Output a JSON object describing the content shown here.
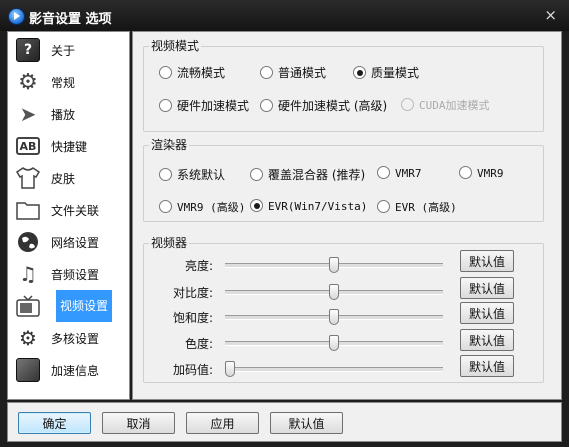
{
  "window": {
    "title": "影音设置 选项",
    "close_label": "×"
  },
  "sidebar": {
    "items": [
      {
        "label": "关于",
        "icon": "help-book-icon"
      },
      {
        "label": "常规",
        "icon": "gear-icon"
      },
      {
        "label": "播放",
        "icon": "play-arrow-icon"
      },
      {
        "label": "快捷键",
        "icon": "keyboard-ab-icon"
      },
      {
        "label": "皮肤",
        "icon": "tshirt-icon"
      },
      {
        "label": "文件关联",
        "icon": "folder-icon"
      },
      {
        "label": "网络设置",
        "icon": "globe-icon"
      },
      {
        "label": "音频设置",
        "icon": "music-note-icon"
      },
      {
        "label": "视频设置",
        "icon": "tv-icon"
      },
      {
        "label": "多核设置",
        "icon": "chip-gear-icon"
      },
      {
        "label": "加速信息",
        "icon": "info-panel-icon"
      }
    ],
    "selected": "视频设置"
  },
  "video_mode": {
    "title": "视频模式",
    "options": [
      "流畅模式",
      "普通模式",
      "质量模式",
      "硬件加速模式",
      "硬件加速模式 (高级)",
      "CUDA加速模式"
    ],
    "selected": "质量模式",
    "disabled": [
      "CUDA加速模式"
    ]
  },
  "renderer": {
    "title": "渲染器",
    "options": [
      "系统默认",
      "覆盖混合器 (推荐)",
      "VMR7",
      "VMR9",
      "VMR9 (高级)",
      "EVR(Win7/Vista)",
      "EVR (高级)"
    ],
    "selected": "EVR(Win7/Vista)"
  },
  "video_adjust": {
    "title": "视频器",
    "sliders": [
      {
        "label": "亮度:",
        "value": 50,
        "button": "默认值"
      },
      {
        "label": "对比度:",
        "value": 50,
        "button": "默认值"
      },
      {
        "label": "饱和度:",
        "value": 50,
        "button": "默认值"
      },
      {
        "label": "色度:",
        "value": 50,
        "button": "默认值"
      },
      {
        "label": "加码值:",
        "value": 0,
        "button": "默认值"
      }
    ]
  },
  "footer": {
    "ok": "确定",
    "cancel": "取消",
    "apply": "应用",
    "default": "默认值"
  },
  "colors": {
    "selection": "#3399ff",
    "titlebar": "#1e1e1e",
    "panel": "#f0f0f0"
  }
}
